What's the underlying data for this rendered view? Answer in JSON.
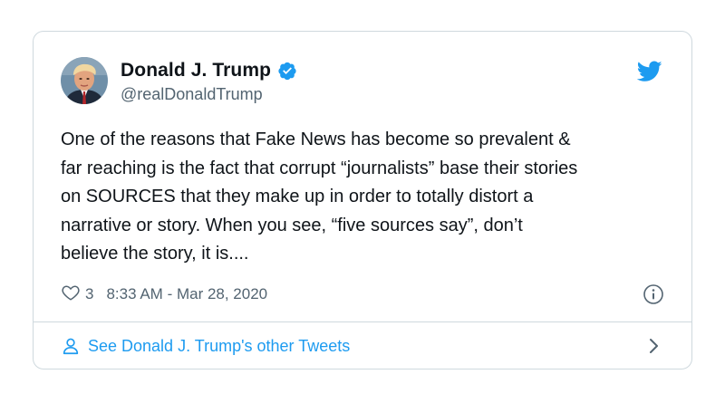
{
  "tweet": {
    "author": {
      "display_name": "Donald J. Trump",
      "handle": "@realDonaldTrump",
      "verified": true,
      "avatar_icon": "user-avatar-photo"
    },
    "text": "One of the reasons that Fake News has become so prevalent &\nfar reaching is the fact that corrupt “journalists” base their stories\non SOURCES that they make up in order to totally distort a\nnarrative or story. When you see, “five sources say”, don’t\nbelieve the story, it is....",
    "like_count": "3",
    "timestamp": "8:33 AM - Mar 28, 2020",
    "footer_link": "See Donald J. Trump's other Tweets"
  },
  "icons": {
    "brand": "twitter-bird-icon",
    "verified": "verified-badge-icon",
    "like": "heart-icon",
    "info": "info-icon",
    "person": "person-icon",
    "chevron": "chevron-right-icon"
  },
  "colors": {
    "brand_blue": "#1d9bf0",
    "text_primary": "#0f1419",
    "text_secondary": "#536471",
    "border": "#cfd9de"
  }
}
